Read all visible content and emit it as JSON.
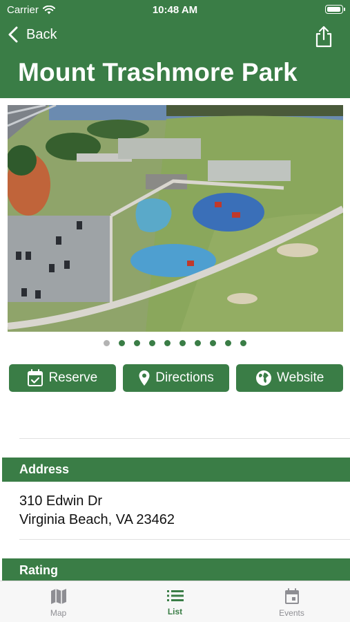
{
  "status_bar": {
    "carrier": "Carrier",
    "time": "10:48 AM"
  },
  "nav": {
    "back_label": "Back"
  },
  "page_title": "Mount Trashmore Park",
  "carousel": {
    "total_pages": 10,
    "current_page": 1
  },
  "actions": [
    {
      "label": "Reserve",
      "icon": "calendar-check-icon"
    },
    {
      "label": "Directions",
      "icon": "location-pin-icon"
    },
    {
      "label": "Website",
      "icon": "globe-icon"
    }
  ],
  "address": {
    "header": "Address",
    "line1": "310 Edwin Dr",
    "line2": "Virginia Beach, VA 23462"
  },
  "rating": {
    "header": "Rating"
  },
  "tabs": [
    {
      "label": "Map",
      "icon": "map-icon",
      "active": false
    },
    {
      "label": "List",
      "icon": "list-icon",
      "active": true
    },
    {
      "label": "Events",
      "icon": "calendar-icon",
      "active": false
    }
  ],
  "colors": {
    "brand_green": "#3a7d46",
    "inactive_dot": "#b3b3b3",
    "tab_inactive": "#8e8e93"
  }
}
